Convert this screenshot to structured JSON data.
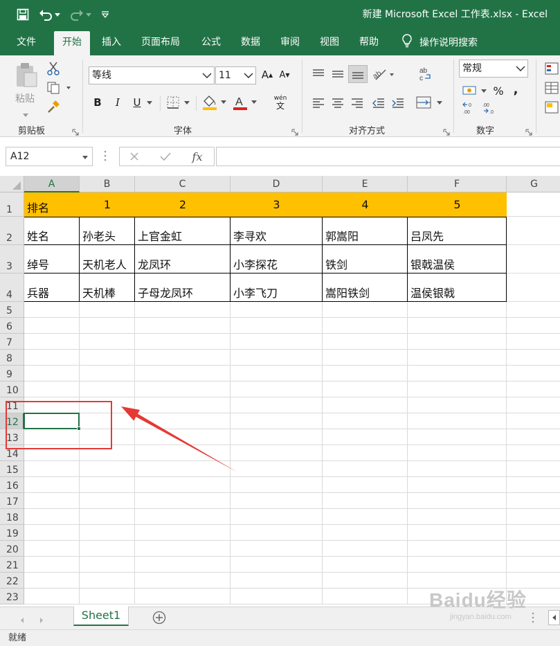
{
  "title_bar": {
    "title": "新建 Microsoft Excel 工作表.xlsx  -  Excel",
    "bg_color": "#217346"
  },
  "quick_access": {
    "icons": [
      "save-icon",
      "undo-icon",
      "redo-icon",
      "customize-qat-icon"
    ]
  },
  "menu": {
    "tabs": [
      "文件",
      "开始",
      "插入",
      "页面布局",
      "公式",
      "数据",
      "审阅",
      "视图",
      "帮助"
    ],
    "active": "开始",
    "tell_me": "操作说明搜索"
  },
  "ribbon": {
    "clipboard": {
      "paste_label": "粘贴",
      "group_label": "剪贴板"
    },
    "font": {
      "font_name": "等线",
      "font_size": "11",
      "grow_label": "A",
      "shrink_label": "A",
      "bold": "B",
      "italic": "I",
      "underline": "U",
      "font_color_label": "A",
      "phonetic_label": "wén",
      "group_label": "字体"
    },
    "alignment": {
      "group_label": "对齐方式"
    },
    "number": {
      "format": "常规",
      "percent": "%",
      "comma": ",",
      "group_label": "数字"
    }
  },
  "formula_bar": {
    "name_box": "A12",
    "fx": "fx",
    "value": ""
  },
  "sheet": {
    "columns": [
      "A",
      "B",
      "C",
      "D",
      "E",
      "F",
      "G"
    ],
    "rows": [
      "1",
      "2",
      "3",
      "4",
      "5",
      "6",
      "7",
      "8",
      "9",
      "10",
      "11",
      "12",
      "13",
      "14",
      "15",
      "16",
      "17",
      "18",
      "19",
      "20",
      "21",
      "22",
      "23"
    ],
    "selected_cell": "A12",
    "header_fill": "#ffc000",
    "data": [
      [
        "排名",
        "1",
        "2",
        "3",
        "4",
        "5"
      ],
      [
        "姓名",
        "孙老头",
        "上官金虹",
        "李寻欢",
        "郭嵩阳",
        "吕凤先"
      ],
      [
        "绰号",
        "天机老人",
        "龙凤环",
        "小李探花",
        "铁剑",
        "银戟温侯"
      ],
      [
        "兵器",
        "天机棒",
        "子母龙凤环",
        "小李飞刀",
        "嵩阳铁剑",
        "温侯银戟"
      ]
    ]
  },
  "sheet_tabs": {
    "tabs": [
      "Sheet1"
    ],
    "active": "Sheet1"
  },
  "status_bar": {
    "status": "就绪"
  },
  "annotation": {
    "color": "#e53935"
  },
  "watermark": {
    "main": "Baidu经验",
    "sub": "jingyan.baidu.com"
  }
}
